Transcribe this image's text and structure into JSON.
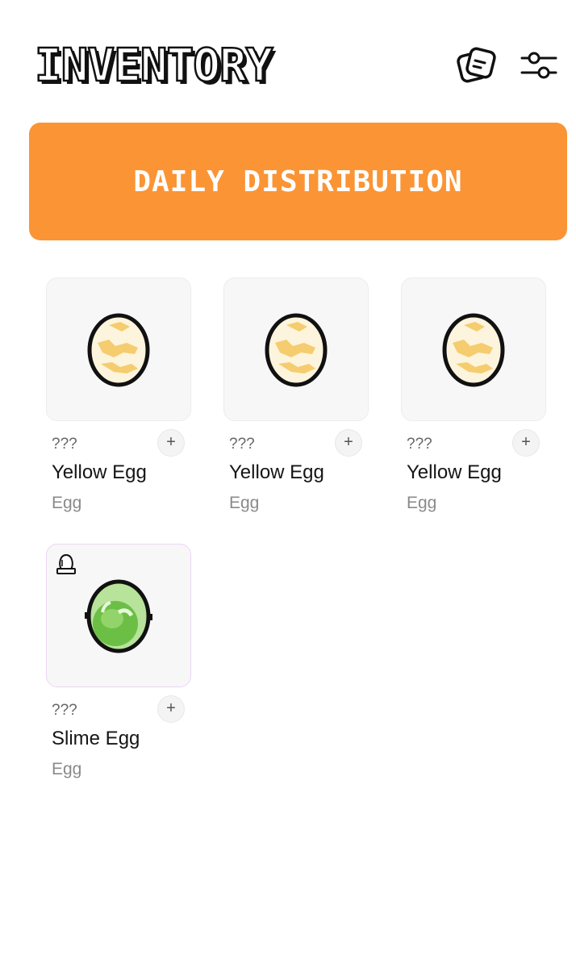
{
  "header": {
    "title": "INVENTORY",
    "notes_icon": "notes-icon",
    "filter_icon": "sliders-icon"
  },
  "banner": {
    "label": "DAILY DISTRIBUTION",
    "color": "#fb9434"
  },
  "items": [
    {
      "name": "Yellow Egg",
      "type": "Egg",
      "unknown": "???",
      "add": "+",
      "icon": "yellow-egg-icon"
    },
    {
      "name": "Yellow Egg",
      "type": "Egg",
      "unknown": "???",
      "add": "+",
      "icon": "yellow-egg-icon"
    },
    {
      "name": "Yellow Egg",
      "type": "Egg",
      "unknown": "???",
      "add": "+",
      "icon": "yellow-egg-icon"
    },
    {
      "name": "Slime Egg",
      "type": "Egg",
      "unknown": "???",
      "add": "+",
      "icon": "slime-egg-icon",
      "badge": "incubator-icon"
    }
  ]
}
